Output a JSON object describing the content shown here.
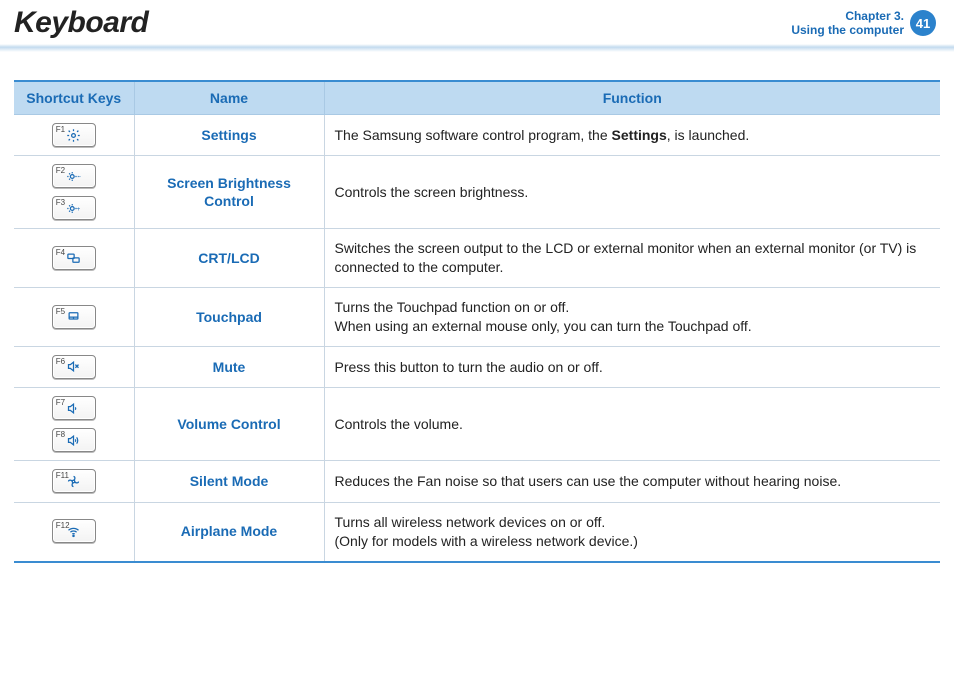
{
  "header": {
    "title": "Keyboard",
    "chapter_label": "Chapter 3.",
    "chapter_sub": "Using the computer",
    "page_number": "41"
  },
  "table": {
    "headers": {
      "c1": "Shortcut Keys",
      "c2": "Name",
      "c3": "Function"
    },
    "rows": [
      {
        "keys": [
          {
            "f": "F1",
            "icon": "settings"
          }
        ],
        "name": "Settings",
        "func_pre": "The Samsung software control program, the ",
        "func_bold": "Settings",
        "func_post": ", is launched."
      },
      {
        "keys": [
          {
            "f": "F2",
            "icon": "bright-minus"
          },
          {
            "f": "F3",
            "icon": "bright-plus"
          }
        ],
        "name": "Screen Brightness Control",
        "func": "Controls the screen brightness."
      },
      {
        "keys": [
          {
            "f": "F4",
            "icon": "crt-lcd"
          }
        ],
        "name": "CRT/LCD",
        "func": "Switches the screen output to the LCD or external monitor when an external monitor (or TV) is connected to the computer."
      },
      {
        "keys": [
          {
            "f": "F5",
            "icon": "touchpad"
          }
        ],
        "name": "Touchpad",
        "func_line1": "Turns the Touchpad function on or off.",
        "func_line2": "When using an external mouse only, you can turn the Touchpad off."
      },
      {
        "keys": [
          {
            "f": "F6",
            "icon": "mute"
          }
        ],
        "name": "Mute",
        "func": "Press this button to turn the audio on or off."
      },
      {
        "keys": [
          {
            "f": "F7",
            "icon": "vol-down"
          },
          {
            "f": "F8",
            "icon": "vol-up"
          }
        ],
        "name": "Volume Control",
        "func": "Controls the volume."
      },
      {
        "keys": [
          {
            "f": "F11",
            "icon": "silent"
          }
        ],
        "name": "Silent Mode",
        "func": "Reduces the Fan noise so that users can use the computer without hearing noise."
      },
      {
        "keys": [
          {
            "f": "F12",
            "icon": "airplane"
          }
        ],
        "name": "Airplane Mode",
        "func_line1": "Turns all wireless network devices on or off.",
        "func_line2": "(Only for models with a wireless network device.)"
      }
    ]
  }
}
